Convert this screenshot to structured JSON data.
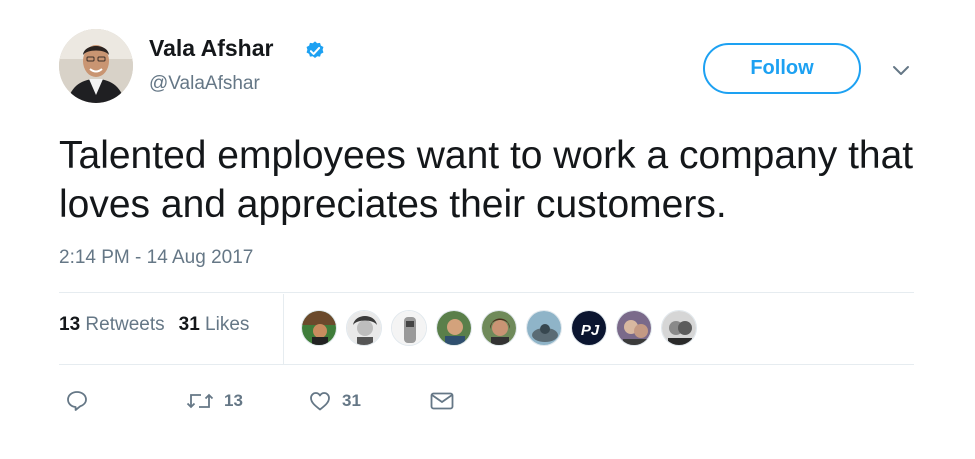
{
  "author": {
    "name": "Vala Afshar",
    "handle": "@ValaAfshar",
    "verified_icon": "verified-badge-icon",
    "avatar_icon": "profile-photo"
  },
  "follow_button": {
    "label": "Follow"
  },
  "menu": {
    "icon": "chevron-down-icon"
  },
  "tweet": {
    "text": "Talented employees want to work a company that loves and appreciates their customers.",
    "timestamp": "2:14 PM - 14 Aug 2017"
  },
  "stats": {
    "retweets_count": "13",
    "retweets_label": "Retweets",
    "likes_count": "31",
    "likes_label": "Likes"
  },
  "likers": [
    "liker-avatar",
    "liker-avatar",
    "liker-avatar",
    "liker-avatar",
    "liker-avatar",
    "liker-avatar",
    "liker-avatar",
    "liker-avatar",
    "liker-avatar"
  ],
  "actions": {
    "reply_icon": "reply-icon",
    "retweet_icon": "retweet-icon",
    "retweet_count": "13",
    "like_icon": "heart-icon",
    "like_count": "31",
    "message_icon": "envelope-icon"
  },
  "colors": {
    "accent": "#1da1f2",
    "secondary_text": "#657786",
    "primary_text": "#14171a",
    "divider": "#e6ecf0"
  }
}
